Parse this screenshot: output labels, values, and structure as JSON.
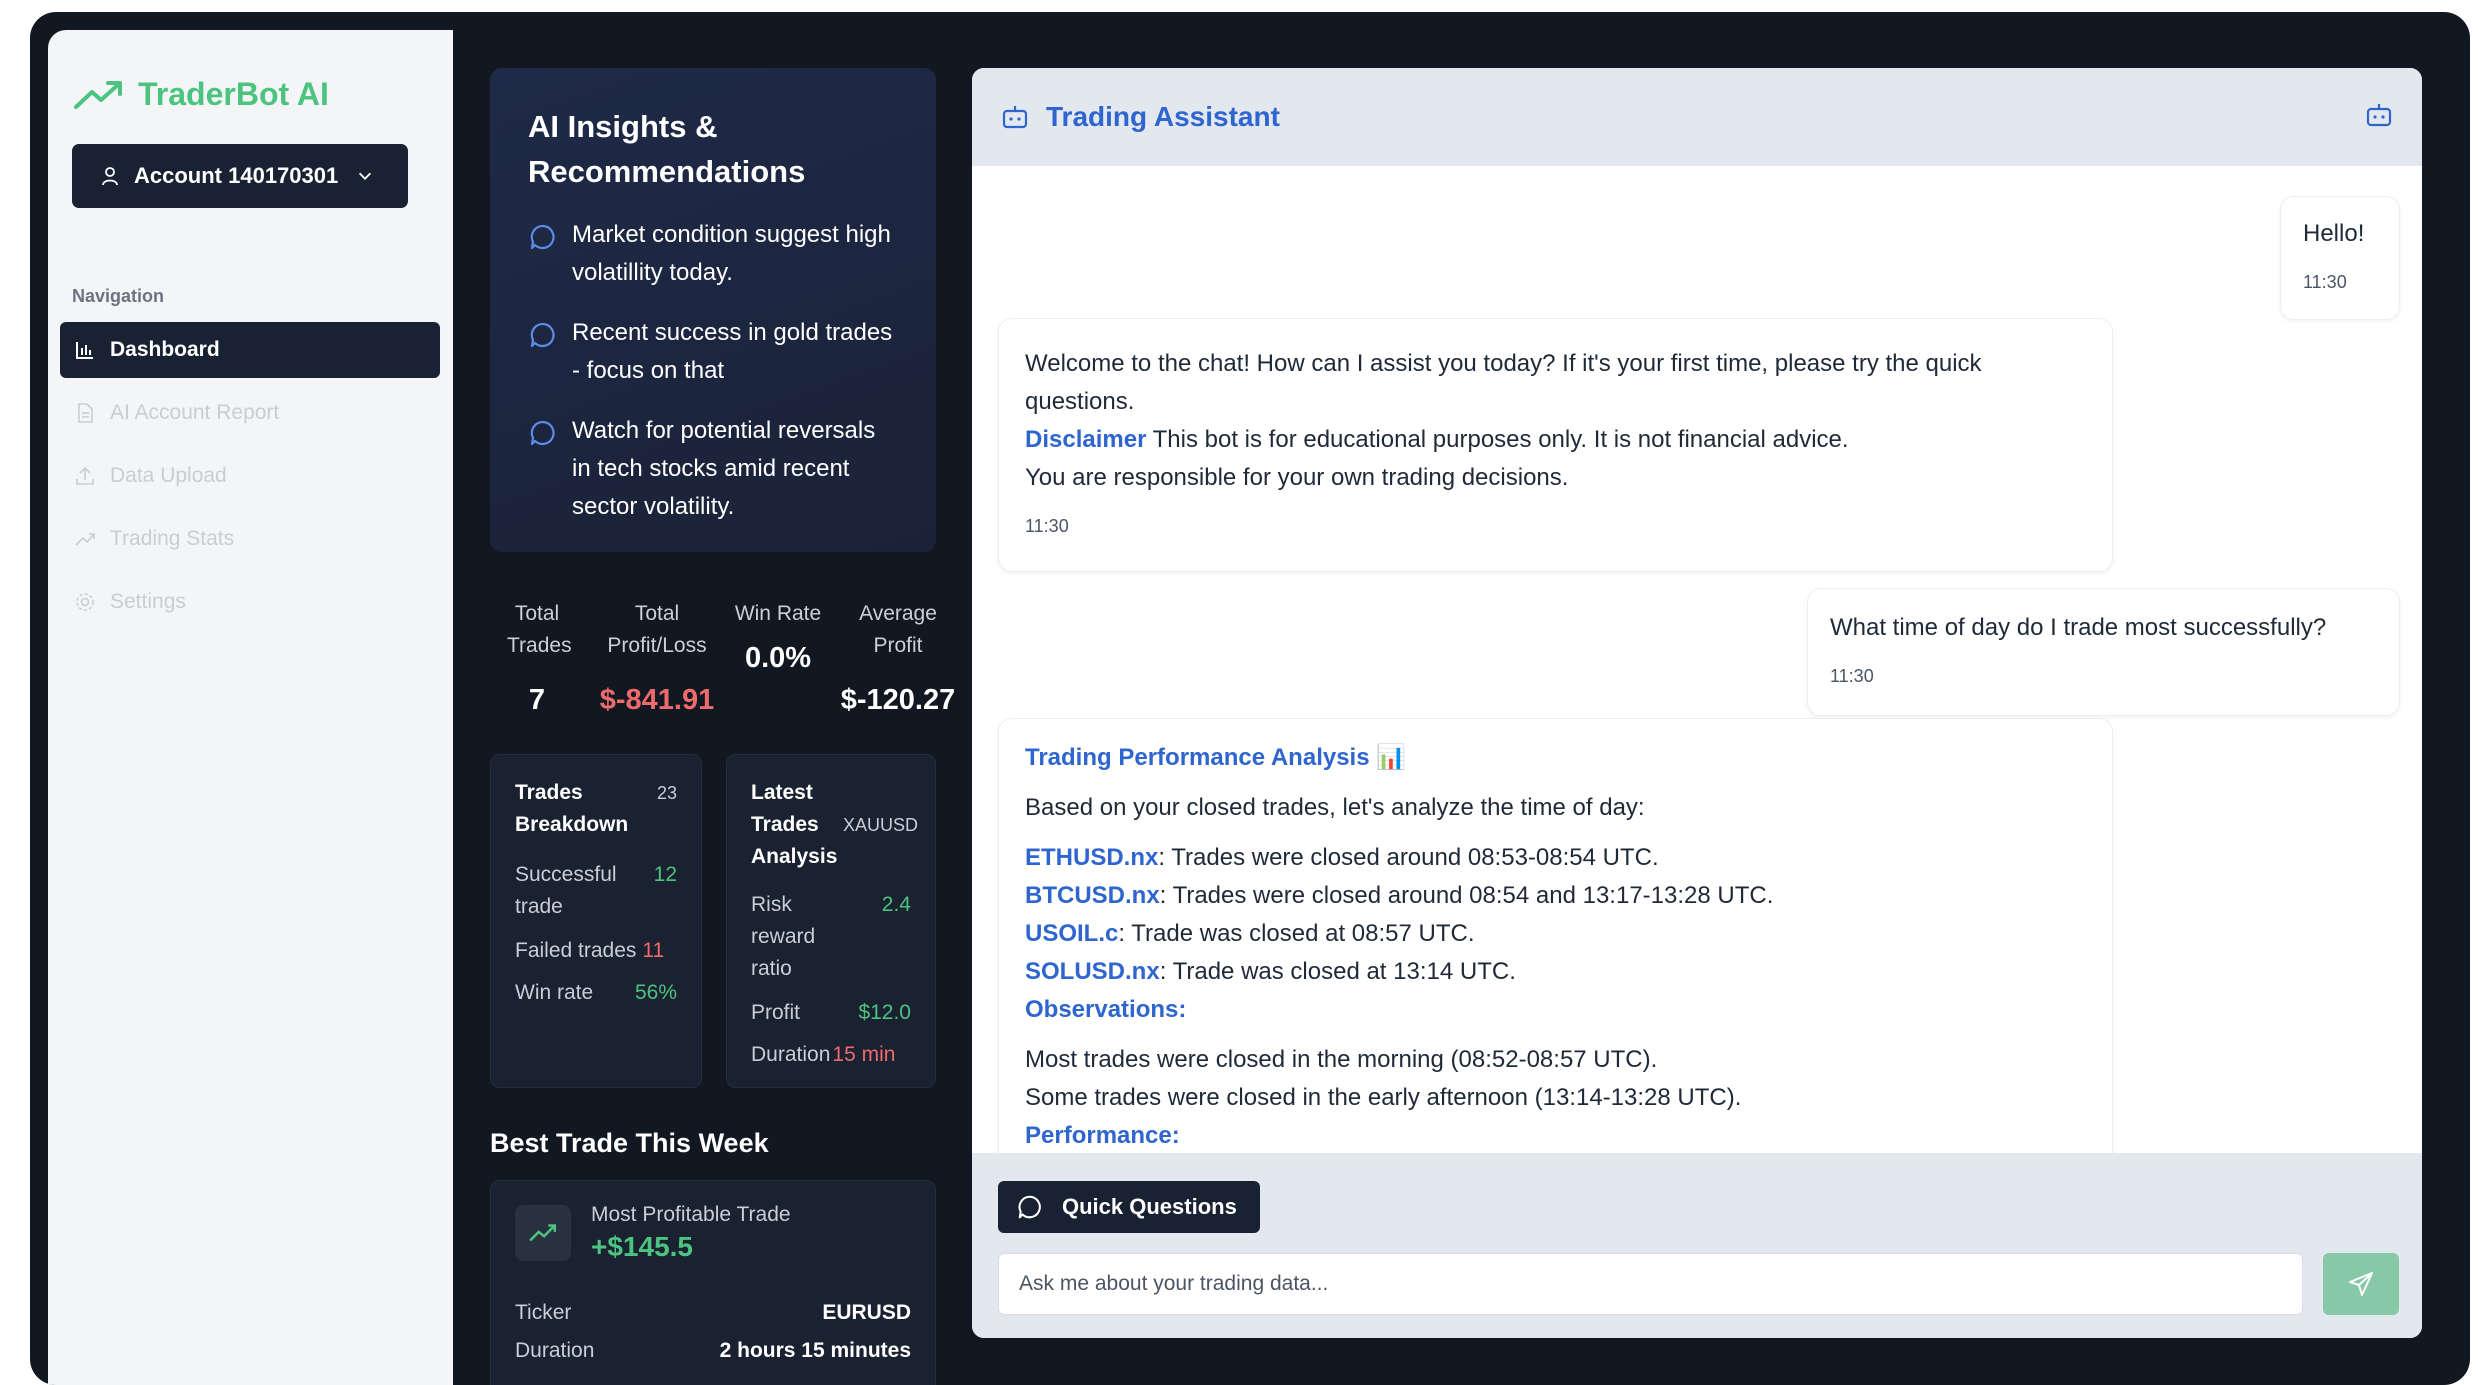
{
  "brand": {
    "name": "TraderBot AI",
    "icon": "trending-up-icon",
    "color": "#4cc37f"
  },
  "account": {
    "label": "Account 140170301"
  },
  "navigation": {
    "heading": "Navigation",
    "items": [
      {
        "label": "Dashboard",
        "icon": "bar-chart-icon",
        "active": true
      },
      {
        "label": "AI Account Report",
        "icon": "file-icon",
        "active": false
      },
      {
        "label": "Data Upload",
        "icon": "upload-icon",
        "active": false
      },
      {
        "label": "Trading Stats",
        "icon": "trending-up-icon",
        "active": false
      },
      {
        "label": "Settings",
        "icon": "gear-icon",
        "active": false
      }
    ]
  },
  "insights": {
    "title": "AI Insights & Recommendations",
    "items": [
      "Market condition suggest high volatillity today.",
      "Recent success in gold trades - focus on that",
      "Watch for potential reversals in tech stocks amid recent sector volatility."
    ]
  },
  "stats": {
    "total_trades": {
      "label": "Total Trades",
      "value": "7"
    },
    "total_pl": {
      "label": "Total Profit/Loss",
      "value": "$-841.91"
    },
    "win_rate": {
      "label": "Win Rate",
      "value": "0.0%"
    },
    "avg_profit": {
      "label": "Average Profit",
      "value": "$-120.27"
    }
  },
  "breakdown": {
    "title": "Trades Breakdown",
    "count": "23",
    "successful_label": "Successful trade",
    "successful_value": "12",
    "failed_label": "Failed trades",
    "failed_value": "11",
    "win_rate_label": "Win rate",
    "win_rate_value": "56%"
  },
  "latest": {
    "title": "Latest Trades Analysis",
    "ticker": "XAUUSD",
    "rr_label": "Risk reward ratio",
    "rr_value": "2.4",
    "profit_label": "Profit",
    "profit_value": "$12.0",
    "duration_label": "Duration",
    "duration_value": "15 min"
  },
  "best_trade": {
    "heading": "Best Trade This Week",
    "label": "Most Profitable Trade",
    "value": "+$145.5",
    "ticker_label": "Ticker",
    "ticker_value": "EURUSD",
    "duration_label": "Duration",
    "duration_value": "2 hours 15 minutes"
  },
  "chat": {
    "title": "Trading Assistant",
    "messages": {
      "m1": {
        "text": "Hello!",
        "time": "11:30"
      },
      "m2": {
        "line1": "Welcome to the chat! How can I assist you today? If it's your first time, please try the quick questions.",
        "disclaimer_label": "Disclaimer",
        "disclaimer_text": " This bot is for educational purposes only. It is not financial advice.",
        "line3": "You are responsible for your own trading decisions.",
        "time": "11:30"
      },
      "m3": {
        "text": "What time of day do I trade most successfully?",
        "time": "11:30"
      },
      "m4": {
        "title": "Trading Performance Analysis 📊",
        "intro": "Based on your closed trades, let's analyze the time of day:",
        "rows": [
          {
            "ticker": "ETHUSD.nx",
            "text": ": Trades were closed around 08:53-08:54 UTC."
          },
          {
            "ticker": "BTCUSD.nx",
            "text": ": Trades were closed around 08:54 and 13:17-13:28 UTC."
          },
          {
            "ticker": "USOIL.c",
            "text": ": Trade was closed at 08:57 UTC."
          },
          {
            "ticker": "SOLUSD.nx",
            "text": ": Trade was closed at 13:14 UTC."
          }
        ],
        "observations_label": "Observations:",
        "obs1": "Most trades were closed in the morning (08:52-08:57 UTC).",
        "obs2": "Some trades were closed in the early afternoon (13:14-13:28 UTC).",
        "performance_label": "Performance:"
      }
    },
    "quick_questions_label": "Quick Questions",
    "input_placeholder": "Ask me about your trading data..."
  }
}
